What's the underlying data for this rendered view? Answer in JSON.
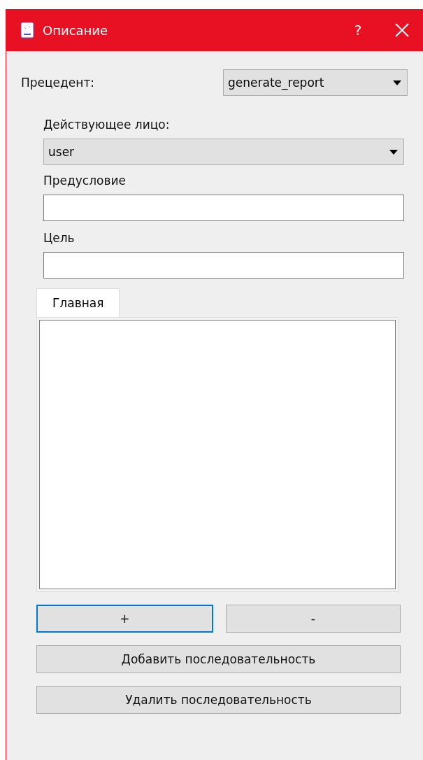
{
  "window": {
    "title": "Описание",
    "help": "?"
  },
  "use_case": {
    "label": "Прецедент:",
    "value": "generate_report"
  },
  "actor": {
    "label": "Действующее лицо:",
    "value": "user"
  },
  "fields": [
    {
      "label": "Предусловие"
    },
    {
      "label": "Цель"
    }
  ],
  "tabs": [
    {
      "label": "Главная",
      "selected": true
    }
  ],
  "step_buttons": [
    {
      "label": "+",
      "focused": true
    },
    {
      "label": "-",
      "focused": false
    }
  ],
  "buttons": [
    {
      "label": "Добавить последовательность",
      "focused": false
    },
    {
      "label": "Удалить последовательность",
      "focused": false
    }
  ]
}
